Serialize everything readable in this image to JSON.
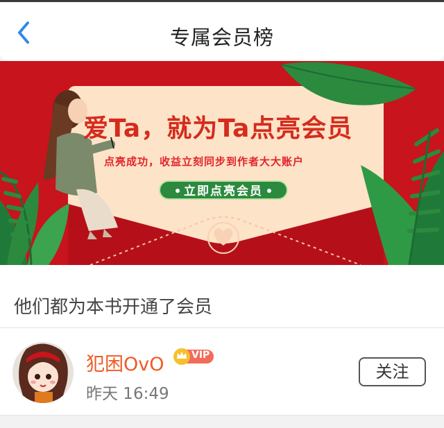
{
  "header": {
    "title": "专属会员榜",
    "back_icon": "chevron-left-icon"
  },
  "banner": {
    "headline": "爱Ta，就为Ta点亮会员",
    "subline": "点亮成功，收益立刻同步到作者大大账户",
    "cta_label": "立即点亮会员",
    "colors": {
      "background": "#c8141c",
      "card": "#fde3c7",
      "cta": "#2b8a3e"
    }
  },
  "section": {
    "title": "他们都为本书开通了会员"
  },
  "members": [
    {
      "name": "犯困OvO",
      "badge": "VIP",
      "time": "昨天 16:49",
      "follow_label": "关注"
    }
  ],
  "colors": {
    "accent": "#f05a24",
    "link_blue": "#2f8ae6"
  }
}
